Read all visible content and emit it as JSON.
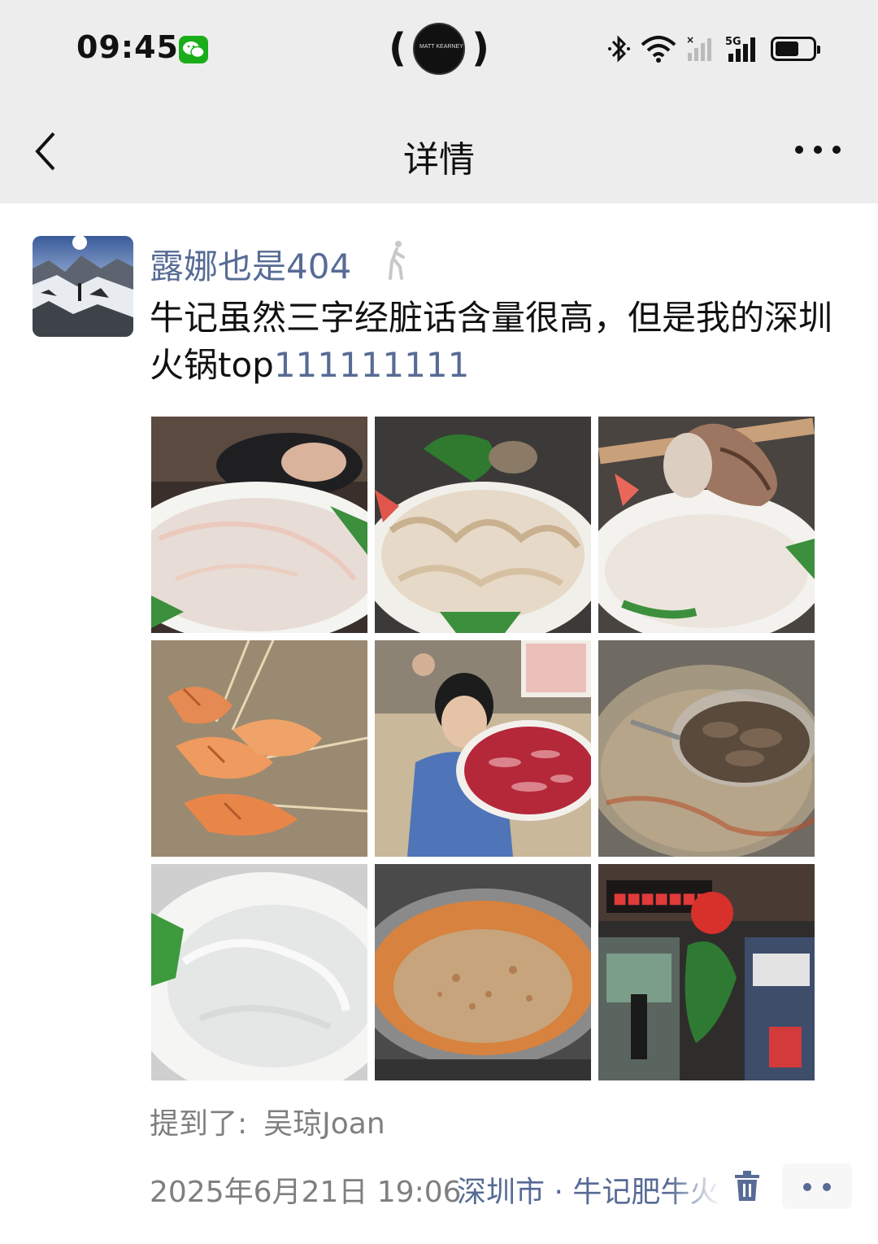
{
  "status_bar": {
    "time": "09:45",
    "island_text": "MATT KEARNEY",
    "network": "5G"
  },
  "nav": {
    "title": "详情"
  },
  "post": {
    "author": "露娜也是404",
    "text_main": "牛记虽然三字经脏话含量很高，但是我的深圳火锅top",
    "text_link": "111111111",
    "images": [
      {
        "icon": "sliced-fish-plate"
      },
      {
        "icon": "sliced-squid-plate"
      },
      {
        "icon": "sliced-conch-plate"
      },
      {
        "icon": "prawn-skewers"
      },
      {
        "icon": "woman-holding-beef-plate"
      },
      {
        "icon": "beef-in-strainer"
      },
      {
        "icon": "clear-jelly-plate"
      },
      {
        "icon": "hotpot-broth"
      },
      {
        "icon": "restaurant-storefront"
      }
    ],
    "mention_label": "提到了:",
    "mention_name": "吴琼Joan",
    "date": "2025年6月21日 19:06",
    "location": "深圳市 · 牛记肥牛火锅"
  },
  "colors": {
    "link": "#576b95",
    "header_bg": "#ededed",
    "secondary_text": "#7f7f7f"
  }
}
